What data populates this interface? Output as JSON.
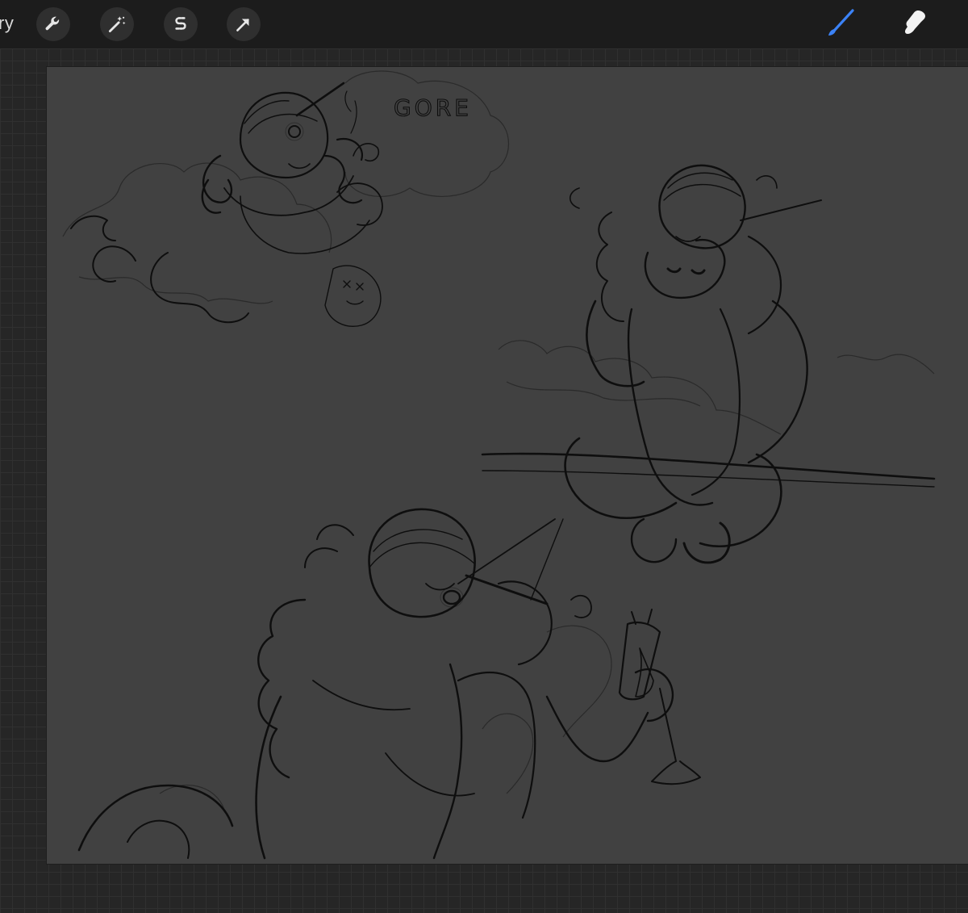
{
  "toolbar": {
    "gallery_label": "ry",
    "left_tools": [
      {
        "name": "actions",
        "icon": "wrench-icon"
      },
      {
        "name": "adjustments",
        "icon": "magic-wand-icon"
      },
      {
        "name": "selection",
        "icon": "selection-s-icon"
      },
      {
        "name": "transform",
        "icon": "arrow-cursor-icon"
      }
    ],
    "right_tools": [
      {
        "name": "brush",
        "icon": "brush-icon",
        "active": true,
        "color": "#3b82f6"
      },
      {
        "name": "smudge",
        "icon": "smudge-icon",
        "active": false,
        "color": "#ffffff"
      }
    ]
  },
  "canvas": {
    "background": "#414141",
    "ink_color": "#0e0e0e",
    "accent_color": "#3dffb8",
    "handwritten_text": "GORE"
  }
}
